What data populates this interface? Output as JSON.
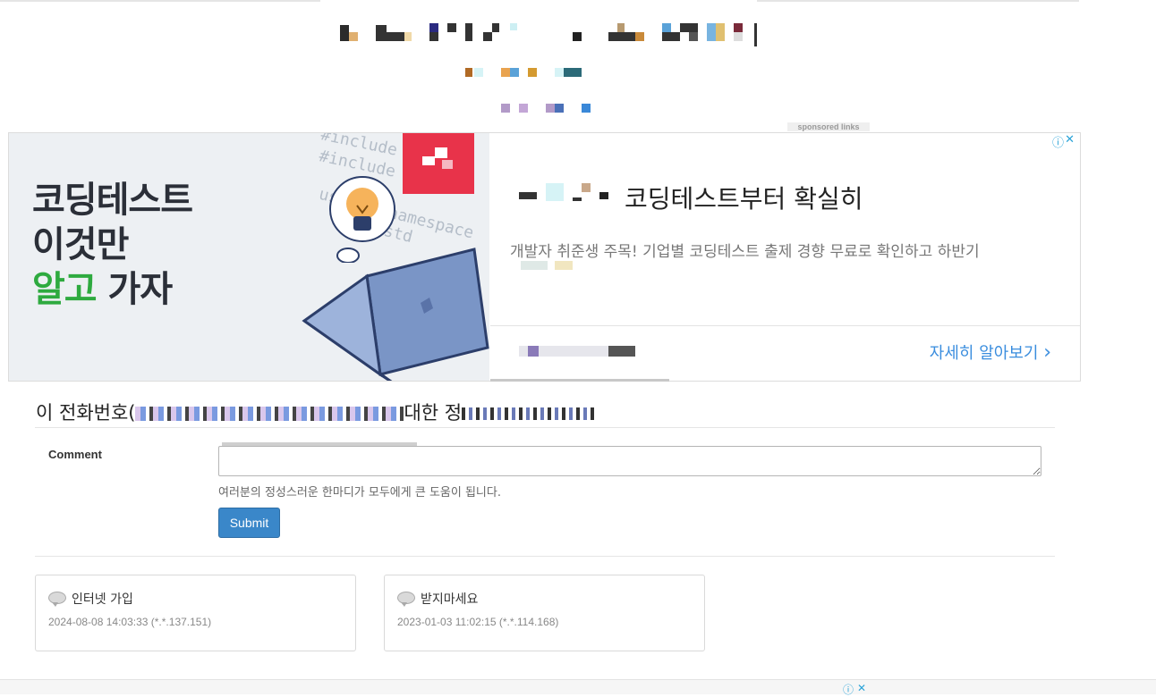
{
  "sponsored_label": "sponsored links",
  "ad": {
    "headline": [
      "코딩테스트",
      "이것만"
    ],
    "headline_green": "알고",
    "headline_rest": "가자",
    "code_lines": [
      "#include",
      "#include",
      "namespace std",
      "using"
    ],
    "title": "코딩테스트부터 확실히",
    "description": "개발자 취준생 주목! 기업별 코딩테스트 출제 경향 무료로 확인하고 하반기",
    "cta": "자세히 알아보기",
    "cta_chevron": "›",
    "close_icon": "✕",
    "info_icon": "ⓘ"
  },
  "page": {
    "title_prefix": "이 전화번호(",
    "title_mid": "대한 정"
  },
  "form": {
    "comment_label": "Comment",
    "help_text": "여러분의 정성스러운 한마디가 모두에게 큰 도움이 됩니다.",
    "submit_label": "Submit"
  },
  "comments": [
    {
      "text": "인터넷 가입",
      "meta": "2024-08-08 14:03:33 (*.*.137.151)"
    },
    {
      "text": "받지마세요",
      "meta": "2023-01-03 11:02:15 (*.*.114.168)"
    }
  ],
  "bottom_ad": {
    "info_icon": "ⓘ",
    "close_icon": "✕"
  }
}
